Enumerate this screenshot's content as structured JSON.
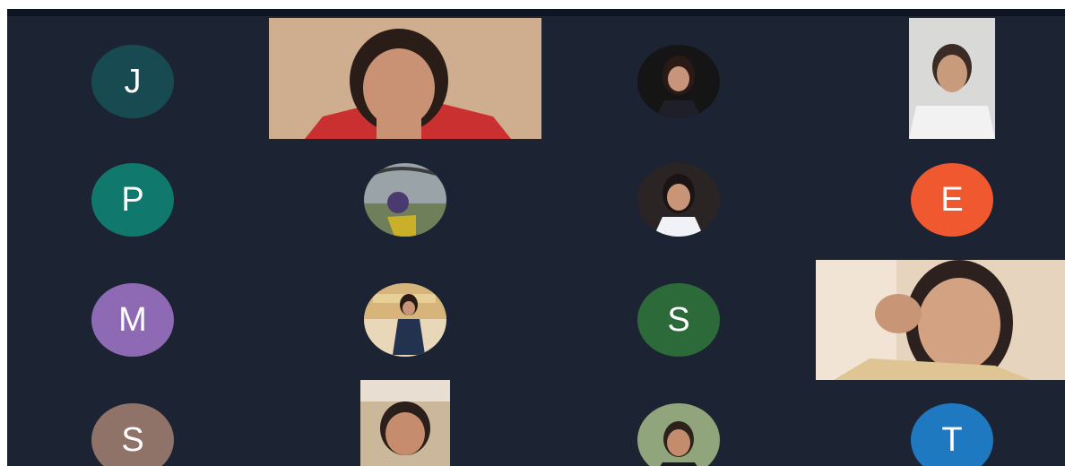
{
  "participants": [
    {
      "initial": "J",
      "color": "#184a52"
    },
    {
      "initial": "P",
      "color": "#11786e"
    },
    {
      "initial": "E",
      "color": "#f0582f"
    },
    {
      "initial": "M",
      "color": "#8e6ab5"
    },
    {
      "initial": "S",
      "color": "#2c6a3a"
    },
    {
      "initial": "S",
      "color": "#8f7368"
    },
    {
      "initial": "T",
      "color": "#1f79c0"
    }
  ],
  "colors": {
    "background": "#1c2333",
    "top_bar": "#0e1420"
  }
}
